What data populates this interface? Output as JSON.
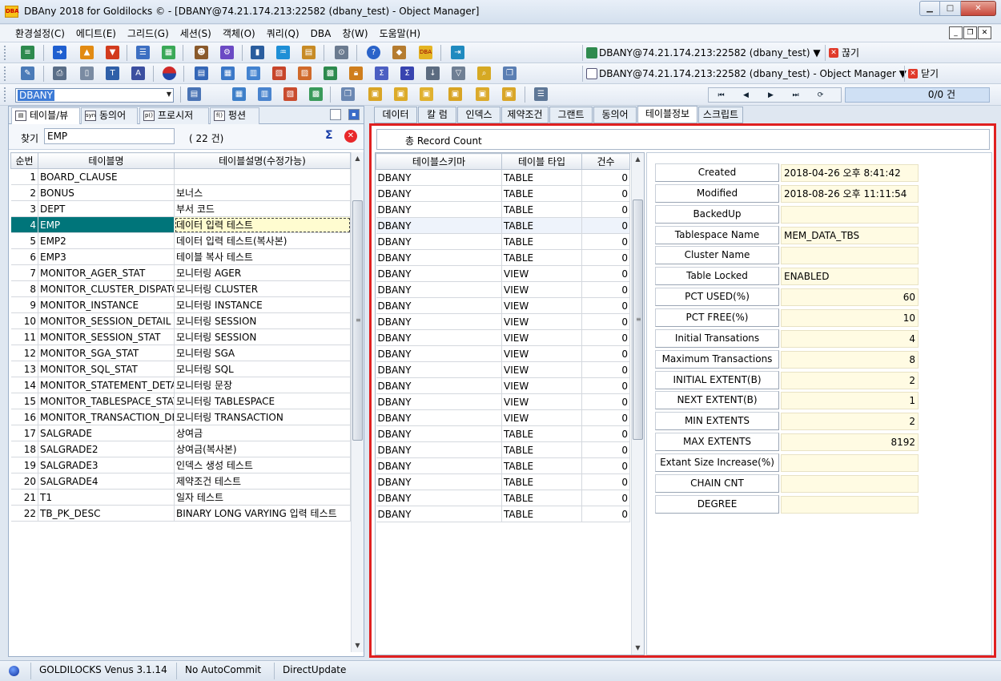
{
  "window": {
    "title": "DBAny 2018 for Goldilocks © - [DBANY@74.21.174.213:22582 (dbany_test) - Object Manager]",
    "app_icon_text": "DBA",
    "min_label": "▁",
    "max_label": "□",
    "close_label": "✕"
  },
  "menu": {
    "items": [
      "환경설정(C)",
      "에디트(E)",
      "그리드(G)",
      "세션(S)",
      "객체(O)",
      "쿼리(Q)",
      "DBA",
      "창(W)",
      "도움말(H)"
    ],
    "mdi_min": "_",
    "mdi_restore": "❐",
    "mdi_close": "✕"
  },
  "toolbar": {
    "connection_label": "DBANY@74.21.174.213:22582 (dbany_test) ▼",
    "disconnect_label": "끊기",
    "window_label": "DBANY@74.21.174.213:22582 (dbany_test) - Object Manager ▼",
    "close_label": "닫기",
    "schema_value": "DBANY",
    "record_count": "0/0 건",
    "nav": [
      "⏮",
      "◀",
      "▶",
      "⏭",
      "⟳"
    ]
  },
  "left": {
    "tabs": [
      "테이블/뷰",
      "동의어",
      "프로시저",
      "펑션"
    ],
    "tab_icons": [
      "▤",
      "syn",
      "p()",
      "f()"
    ],
    "find_label": "찾기",
    "find_value": "EMP",
    "count": "( 22 건)",
    "headers": [
      "순번",
      "테이블명",
      "테이블설명(수정가능)"
    ],
    "rows": [
      [
        "1",
        "BOARD_CLAUSE",
        ""
      ],
      [
        "2",
        "BONUS",
        "보너스"
      ],
      [
        "3",
        "DEPT",
        "부서 코드"
      ],
      [
        "4",
        "EMP",
        "데이터 입력 테스트"
      ],
      [
        "5",
        "EMP2",
        "데이터 입력 테스트(복사본)"
      ],
      [
        "6",
        "EMP3",
        "테이블 복사 테스트"
      ],
      [
        "7",
        "MONITOR_AGER_STAT",
        "모니터링 AGER"
      ],
      [
        "8",
        "MONITOR_CLUSTER_DISPATCH",
        "모니터링 CLUSTER"
      ],
      [
        "9",
        "MONITOR_INSTANCE",
        "모니터링 INSTANCE"
      ],
      [
        "10",
        "MONITOR_SESSION_DETAIL",
        "모니터링 SESSION"
      ],
      [
        "11",
        "MONITOR_SESSION_STAT",
        "모니터링 SESSION"
      ],
      [
        "12",
        "MONITOR_SGA_STAT",
        "모니터링 SGA"
      ],
      [
        "13",
        "MONITOR_SQL_STAT",
        "모니터링 SQL"
      ],
      [
        "14",
        "MONITOR_STATEMENT_DETAIL",
        "모니터링 문장"
      ],
      [
        "15",
        "MONITOR_TABLESPACE_STAT",
        "모니터링 TABLESPACE"
      ],
      [
        "16",
        "MONITOR_TRANSACTION_DETAIL",
        "모니터링 TRANSACTION"
      ],
      [
        "17",
        "SALGRADE",
        "상여금"
      ],
      [
        "18",
        "SALGRADE2",
        "상여금(복사본)"
      ],
      [
        "19",
        "SALGRADE3",
        "인덱스 생성 테스트"
      ],
      [
        "20",
        "SALGRADE4",
        "제약조건 테스트"
      ],
      [
        "21",
        "T1",
        "일자 테스트"
      ],
      [
        "22",
        "TB_PK_DESC",
        "BINARY LONG VARYING 입력 테스트"
      ]
    ]
  },
  "right": {
    "tabs": [
      "데이터",
      "칼 럼",
      "인덱스",
      "제약조건",
      "그랜트",
      "동의어",
      "테이블정보",
      "스크립트"
    ],
    "record_count_label": "총 Record Count",
    "headers": [
      "테이블스키마",
      "테이블 타입",
      "건수"
    ],
    "rows": [
      [
        "DBANY",
        "TABLE",
        "0"
      ],
      [
        "DBANY",
        "TABLE",
        "0"
      ],
      [
        "DBANY",
        "TABLE",
        "0"
      ],
      [
        "DBANY",
        "TABLE",
        "0"
      ],
      [
        "DBANY",
        "TABLE",
        "0"
      ],
      [
        "DBANY",
        "TABLE",
        "0"
      ],
      [
        "DBANY",
        "VIEW",
        "0"
      ],
      [
        "DBANY",
        "VIEW",
        "0"
      ],
      [
        "DBANY",
        "VIEW",
        "0"
      ],
      [
        "DBANY",
        "VIEW",
        "0"
      ],
      [
        "DBANY",
        "VIEW",
        "0"
      ],
      [
        "DBANY",
        "VIEW",
        "0"
      ],
      [
        "DBANY",
        "VIEW",
        "0"
      ],
      [
        "DBANY",
        "VIEW",
        "0"
      ],
      [
        "DBANY",
        "VIEW",
        "0"
      ],
      [
        "DBANY",
        "VIEW",
        "0"
      ],
      [
        "DBANY",
        "TABLE",
        "0"
      ],
      [
        "DBANY",
        "TABLE",
        "0"
      ],
      [
        "DBANY",
        "TABLE",
        "0"
      ],
      [
        "DBANY",
        "TABLE",
        "0"
      ],
      [
        "DBANY",
        "TABLE",
        "0"
      ],
      [
        "DBANY",
        "TABLE",
        "0"
      ]
    ],
    "info": [
      {
        "label": "Created",
        "value": "2018-04-26 오후 8:41:42"
      },
      {
        "label": "Modified",
        "value": "2018-08-26 오후 11:11:54"
      },
      {
        "label": "BackedUp",
        "value": ""
      },
      {
        "label": "Tablespace Name",
        "value": "MEM_DATA_TBS"
      },
      {
        "label": "Cluster Name",
        "value": ""
      },
      {
        "label": "Table Locked",
        "value": "ENABLED"
      },
      {
        "label": "PCT USED(%)",
        "value": "60"
      },
      {
        "label": "PCT FREE(%)",
        "value": "10"
      },
      {
        "label": "Initial Transations",
        "value": "4"
      },
      {
        "label": "Maximum Transactions",
        "value": "8"
      },
      {
        "label": "INITIAL EXTENT(B)",
        "value": "2"
      },
      {
        "label": "NEXT EXTENT(B)",
        "value": "1"
      },
      {
        "label": "MIN EXTENTS",
        "value": "2"
      },
      {
        "label": "MAX EXTENTS",
        "value": "8192"
      },
      {
        "label": "Extant Size Increase(%)",
        "value": ""
      },
      {
        "label": "CHAIN CNT",
        "value": ""
      },
      {
        "label": "DEGREE",
        "value": ""
      }
    ]
  },
  "status": {
    "db": "GOLDILOCKS Venus 3.1.14",
    "commit": "No AutoCommit",
    "update": "DirectUpdate"
  },
  "colors": {
    "selected_row": "#00757a",
    "highlight_border": "#e02020",
    "value_background": "#fffbe3"
  }
}
